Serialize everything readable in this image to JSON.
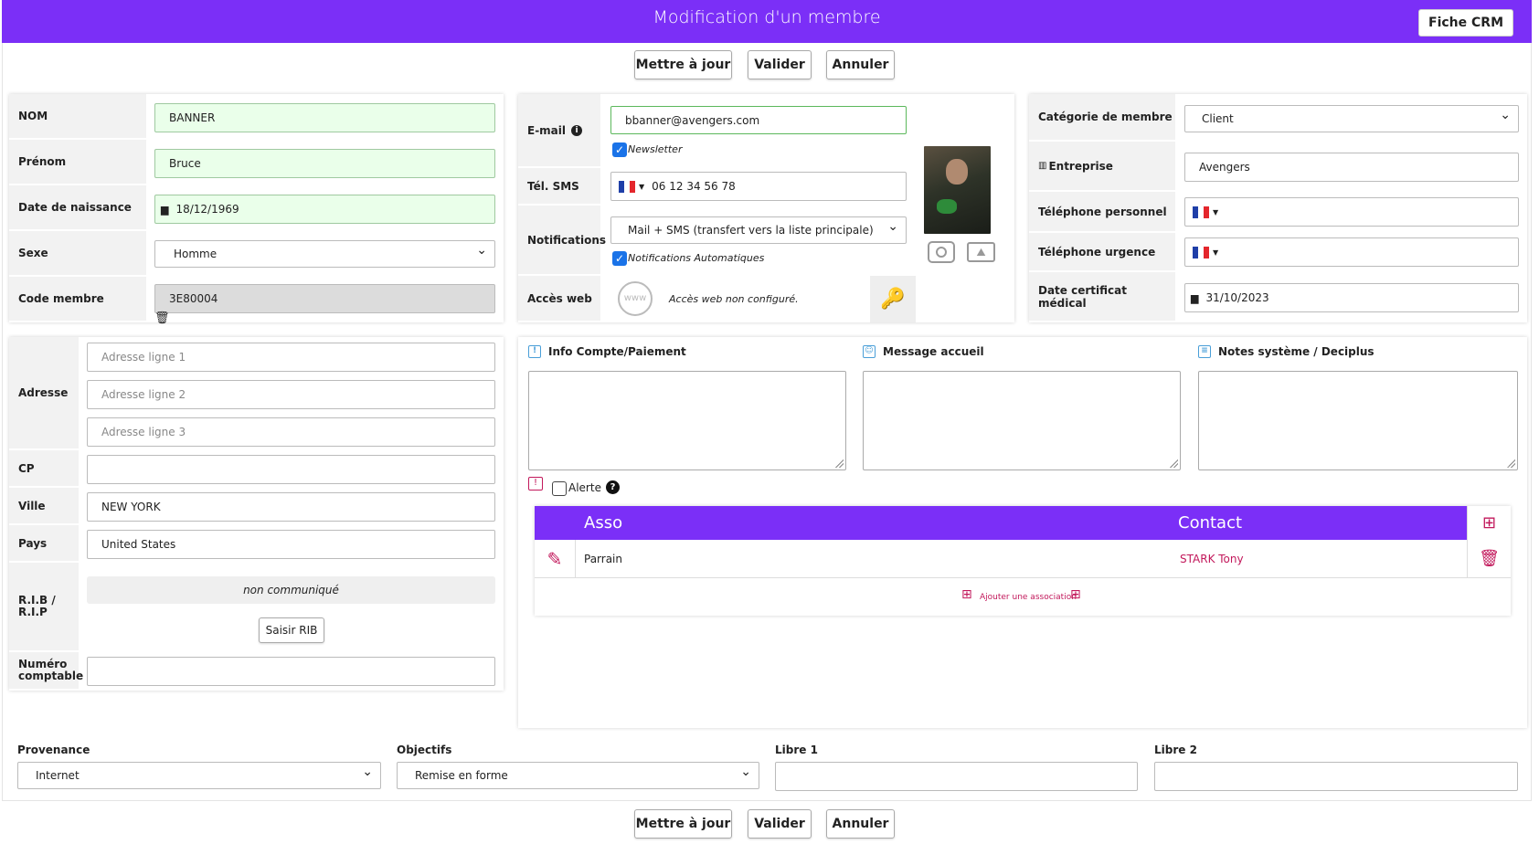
{
  "header": {
    "title": "Modification d'un membre",
    "crm_button": "Fiche CRM"
  },
  "actions": {
    "update": "Mettre à jour",
    "validate": "Valider",
    "cancel": "Annuler"
  },
  "identity": {
    "nom_label": "NOM",
    "nom_value": "BANNER",
    "prenom_label": "Prénom",
    "prenom_value": "Bruce",
    "dob_label": "Date de naissance",
    "dob_value": "18/12/1969",
    "sexe_label": "Sexe",
    "sexe_value": "Homme",
    "code_label": "Code membre",
    "code_value": "3E80004"
  },
  "contact": {
    "email_label": "E-mail",
    "email_value": "bbanner@avengers.com",
    "newsletter_label": "Newsletter",
    "sms_label": "Tél. SMS",
    "sms_value": "06 12 34 56 78",
    "notif_label": "Notifications",
    "notif_value": "Mail + SMS (transfert vers la liste principale)",
    "auto_notif_label": "Notifications Automatiques",
    "web_label": "Accès web",
    "web_status": "Accès web non configuré."
  },
  "member": {
    "category_label": "Catégorie de membre",
    "category_value": "Client",
    "company_label": "Entreprise",
    "company_value": "Avengers",
    "phone_personal_label": "Téléphone personnel",
    "phone_urgent_label": "Téléphone urgence",
    "medical_label": "Date certificat médical",
    "medical_value": "31/10/2023"
  },
  "address": {
    "label": "Adresse",
    "line1_placeholder": "Adresse ligne 1",
    "line2_placeholder": "Adresse ligne 2",
    "line3_placeholder": "Adresse ligne 3",
    "cp_label": "CP",
    "ville_label": "Ville",
    "ville_value": "NEW YORK",
    "pays_label": "Pays",
    "pays_value": "United States",
    "rib_label_1": "R.I.B /",
    "rib_label_2": "R.I.P",
    "rib_value": "non communiqué",
    "rib_button": "Saisir RIB",
    "account_label_1": "Numéro",
    "account_label_2": "comptable"
  },
  "notes": {
    "info_label": "Info Compte/Paiement",
    "welcome_label": "Message accueil",
    "system_label": "Notes système / Deciplus",
    "alert_label": "Alerte"
  },
  "assoc": {
    "col_asso": "Asso",
    "col_contact": "Contact",
    "rows": [
      {
        "asso": "Parrain",
        "contact": "STARK Tony"
      }
    ],
    "add_label": "Ajouter une association"
  },
  "bottom": {
    "provenance_label": "Provenance",
    "provenance_value": "Internet",
    "objectifs_label": "Objectifs",
    "objectifs_value": "Remise en forme",
    "libre1_label": "Libre 1",
    "libre2_label": "Libre 2"
  },
  "colors": {
    "accent": "#7b2ff7",
    "required_bg": "#eaffea",
    "link": "#c2185b"
  }
}
